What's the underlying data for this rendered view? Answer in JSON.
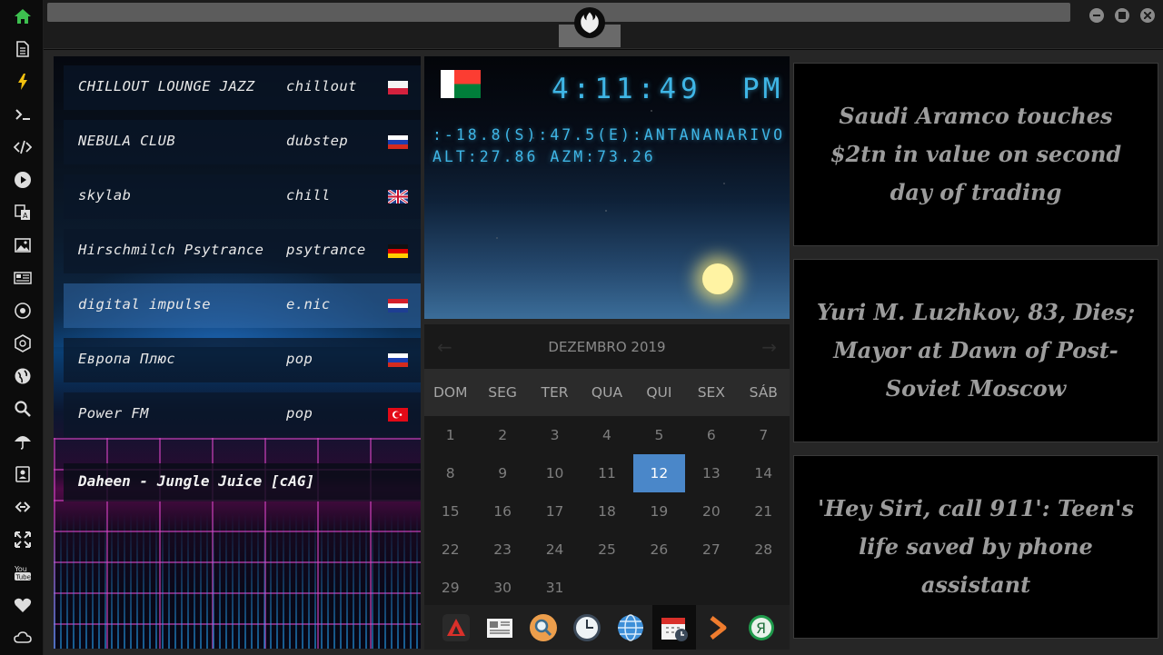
{
  "sidebar": {
    "icons": [
      "home-icon",
      "document-icon",
      "bolt-icon",
      "terminal-icon",
      "code-icon",
      "play-icon",
      "translate-icon",
      "image-icon",
      "newspaper-icon",
      "rebel-alliance-icon",
      "galactic-empire-icon",
      "globe-icon",
      "search-icon",
      "umbrella-icon",
      "contacts-icon",
      "link-icon",
      "fullscreen-icon",
      "youtube-icon",
      "heart-icon",
      "cloud-icon"
    ]
  },
  "window": {
    "title": "",
    "emblem": "rebel-alliance-icon"
  },
  "radio": {
    "stations": [
      {
        "name": "CHILLOUT LOUNGE JAZZ",
        "genre": "chillout",
        "flag": "poland"
      },
      {
        "name": "NEBULA CLUB",
        "genre": "dubstep",
        "flag": "russia"
      },
      {
        "name": "skylab",
        "genre": "chill",
        "flag": "united-kingdom"
      },
      {
        "name": "Hirschmilch Psytrance",
        "genre": "psytrance",
        "flag": "germany"
      },
      {
        "name": "digital impulse",
        "genre": "e.nic",
        "flag": "croatia",
        "active": true
      },
      {
        "name": "Европа Плюс",
        "genre": "pop",
        "flag": "russia"
      },
      {
        "name": "Power FM",
        "genre": "pop",
        "flag": "turkey"
      }
    ],
    "now_playing": "Daheen - Jungle Juice [cAG]"
  },
  "clock": {
    "country_flag": "madagascar",
    "time": "4:11:49",
    "ampm": "PM",
    "coords": ":-18.8(S):47.5(E):ANTANANARIVO",
    "alt_azm": "ALT:27.86 AZM:73.26"
  },
  "calendar": {
    "month_label": "DEZEMBRO 2019",
    "weekdays": [
      "DOM",
      "SEG",
      "TER",
      "QUA",
      "QUI",
      "SEX",
      "SÁB"
    ],
    "days": [
      "1",
      "2",
      "3",
      "4",
      "5",
      "6",
      "7",
      "8",
      "9",
      "10",
      "11",
      "12",
      "13",
      "14",
      "15",
      "16",
      "17",
      "18",
      "19",
      "20",
      "21",
      "22",
      "23",
      "24",
      "25",
      "26",
      "27",
      "28",
      "29",
      "30",
      "31"
    ],
    "selected_day": "12"
  },
  "dock": [
    "ark-app-icon",
    "news-app-icon",
    "search-app-icon",
    "clock-app-icon",
    "globe-app-icon",
    "calendar-app-icon",
    "forward-app-icon",
    "yandex-app-icon"
  ],
  "news": [
    {
      "headline": "Saudi Aramco touches $2tn in value on second day of trading"
    },
    {
      "headline": "Yuri M. Luzhkov, 83, Dies; Mayor at Dawn of Post-Soviet Moscow"
    },
    {
      "headline": "'Hey Siri, call 911': Teen's life saved by phone assistant"
    }
  ],
  "colors": {
    "accent": "#4a87c9",
    "lcd": "#3fb6e6",
    "sidebar_home": "#3dbf4f",
    "sidebar_bolt": "#f2c10f"
  }
}
